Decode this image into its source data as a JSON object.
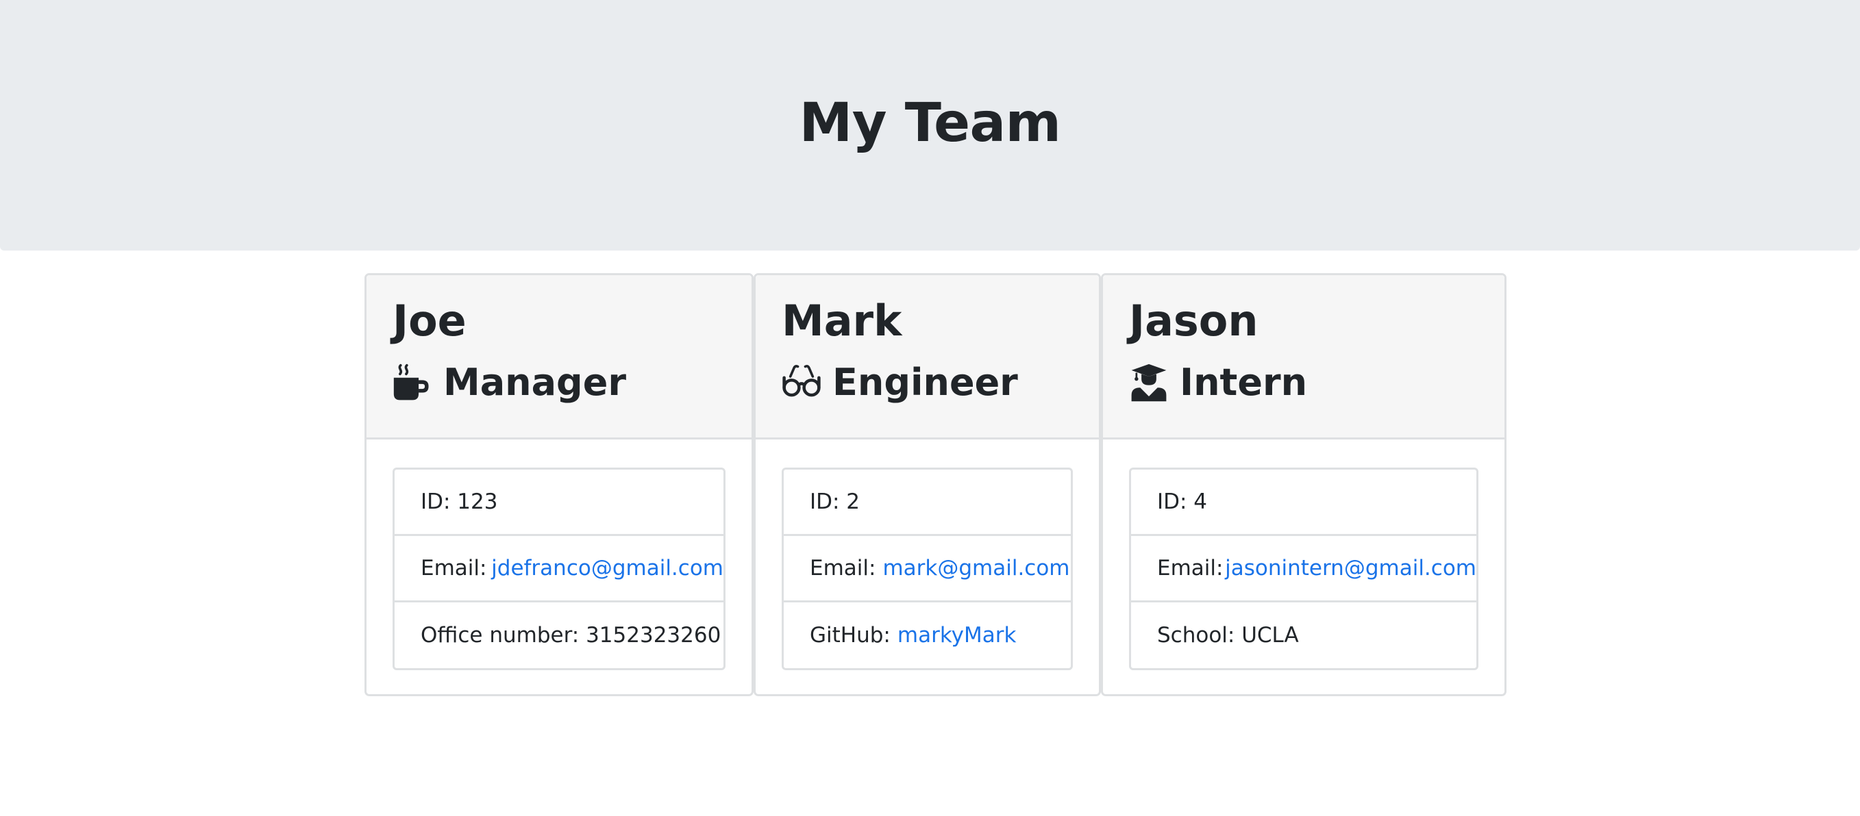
{
  "header": {
    "title": "My Team"
  },
  "colors": {
    "jumbotron": "#e9ecef",
    "link": "#1a73e8",
    "text": "#212529"
  },
  "team": [
    {
      "name": "Joe",
      "role": "Manager",
      "icon": "mug-hot-icon",
      "id_label": "ID: 123",
      "email_label": "Email:",
      "email": "jdefranco@gmail.com",
      "extra_label": "Office number: 3152323260"
    },
    {
      "name": "Mark",
      "role": "Engineer",
      "icon": "glasses-icon",
      "id_label": "ID: 2",
      "email_label": "Email:",
      "email": "mark@gmail.com",
      "extra_label": "GitHub:",
      "extra_link": "markyMark"
    },
    {
      "name": "Jason",
      "role": "Intern",
      "icon": "user-graduate-icon",
      "id_label": "ID: 4",
      "email_label": "Email:",
      "email": "jasonintern@gmail.com",
      "extra_label": "School: UCLA"
    }
  ]
}
